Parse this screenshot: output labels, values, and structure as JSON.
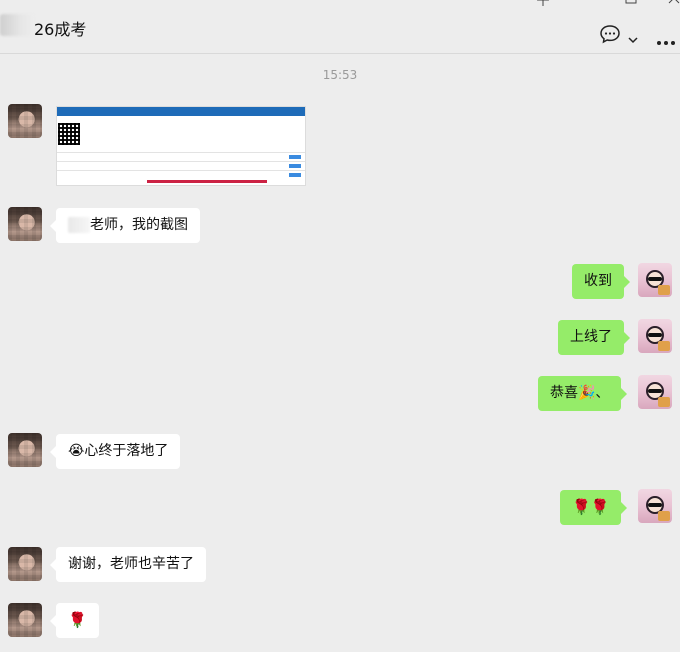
{
  "window": {
    "title": "26成考",
    "controls": [
      "pin",
      "minimize",
      "maximize",
      "close"
    ]
  },
  "toolbar": {
    "chat_icon": "chat-bubble-icon",
    "chevron_icon": "chevron-down-icon",
    "more_icon": "more-icon"
  },
  "chat": {
    "timestamp": "15:53",
    "messages": [
      {
        "side": "in",
        "type": "image"
      },
      {
        "side": "in",
        "type": "text",
        "text": "老师，我的截图"
      },
      {
        "side": "out",
        "type": "text",
        "text": "收到"
      },
      {
        "side": "out",
        "type": "text",
        "text": "上线了"
      },
      {
        "side": "out",
        "type": "text",
        "text": "恭喜🎉、"
      },
      {
        "side": "in",
        "type": "text",
        "text": "😭心终于落地了"
      },
      {
        "side": "out",
        "type": "text",
        "text": "🌹🌹"
      },
      {
        "side": "in",
        "type": "text",
        "text": "谢谢，老师也辛苦了"
      },
      {
        "side": "in",
        "type": "text",
        "text": "🌹"
      }
    ]
  },
  "colors": {
    "background": "#ededed",
    "incoming_bubble": "#ffffff",
    "outgoing_bubble": "#95ec69",
    "timestamp": "#9a9a9a"
  }
}
